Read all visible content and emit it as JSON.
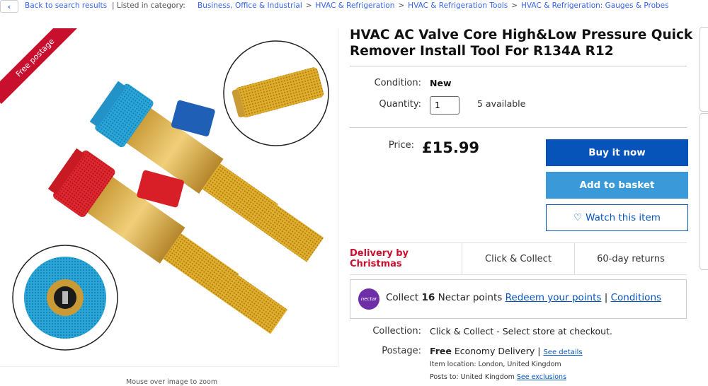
{
  "breadcrumb": {
    "back_icon": "chevron-left-icon",
    "back_label": "Back to search results",
    "listed_label": "| Listed in category:",
    "items": [
      "Business, Office & Industrial",
      "HVAC & Refrigeration",
      "HVAC & Refrigeration Tools",
      "HVAC & Refrigeration: Gauges & Probes"
    ]
  },
  "image": {
    "ribbon": "Free postage",
    "zoom_hint": "Mouse over image to zoom"
  },
  "product": {
    "title": "HVAC AC Valve Core High&Low Pressure Quick Remover Install Tool For R134A R12",
    "condition_label": "Condition:",
    "condition_value": "New",
    "quantity_label": "Quantity:",
    "quantity_value": "1",
    "available": "5 available",
    "price_label": "Price:",
    "price_value": "£15.99"
  },
  "actions": {
    "buy": "Buy it now",
    "basket": "Add to basket",
    "watch": "Watch this item"
  },
  "promos": [
    "Delivery by Christmas",
    "Click & Collect",
    "60-day returns"
  ],
  "nectar": {
    "logo": "nectar",
    "pre": "Collect",
    "points": "16",
    "post": "Nectar points",
    "redeem": "Redeem your points",
    "sep": "|",
    "conditions": "Conditions"
  },
  "shipping": {
    "collection_label": "Collection:",
    "collection_value": "Click & Collect - Select store at checkout.",
    "postage_label": "Postage:",
    "postage_free": "Free",
    "postage_method": "Economy Delivery |",
    "see_details": "See details",
    "item_location": "Item location:  London, United Kingdom",
    "posts_to": "Posts to:  United Kingdom",
    "see_exclusions": "See exclusions"
  },
  "colors": {
    "link": "#3665f3",
    "buy": "#0654ba",
    "basket": "#3a9ad9",
    "ribbon": "#c8102e",
    "delivery": "#c8102e",
    "nectar": "#6d2ea8"
  }
}
